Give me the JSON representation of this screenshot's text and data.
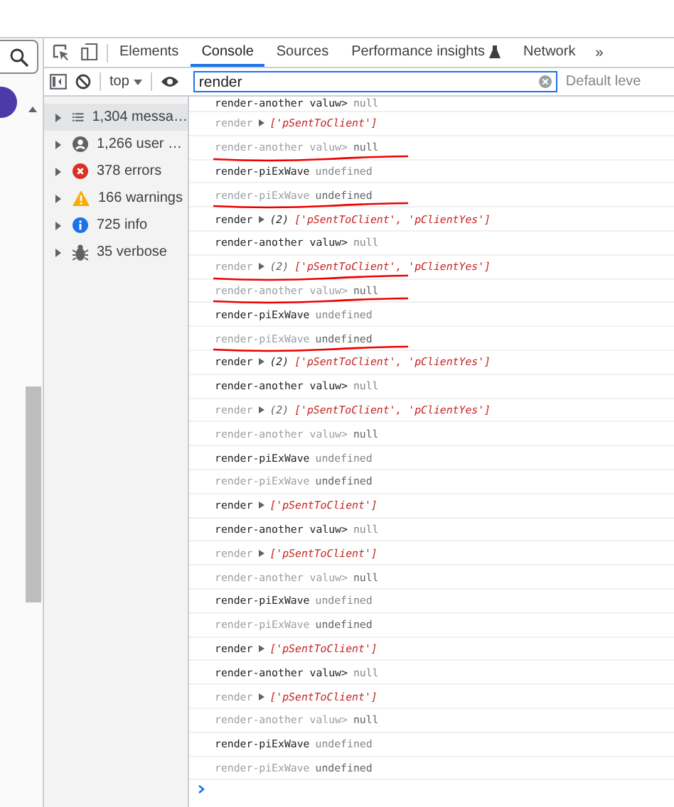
{
  "tabs": [
    {
      "label": "Elements",
      "selected": false
    },
    {
      "label": "Console",
      "selected": true
    },
    {
      "label": "Sources",
      "selected": false
    },
    {
      "label": "Performance insights",
      "selected": false,
      "kind": "flask"
    },
    {
      "label": "Network",
      "selected": false
    }
  ],
  "more_tabs": "»",
  "toolbar": {
    "context": "top",
    "filter": {
      "value": "render"
    },
    "levels": "Default leve"
  },
  "sidebar": {
    "items": [
      {
        "kind": "list",
        "label": "1,304 messa…",
        "selected": true
      },
      {
        "kind": "user",
        "label": "1,266 user …",
        "selected": false
      },
      {
        "kind": "error",
        "label": "378 errors",
        "selected": false
      },
      {
        "kind": "warning",
        "label": "166 warnings",
        "selected": false
      },
      {
        "kind": "info",
        "label": "725 info",
        "selected": false
      },
      {
        "kind": "bug",
        "label": "35 verbose",
        "selected": false
      }
    ]
  },
  "log": [
    {
      "kind": "text",
      "label": "render-another valuw>",
      "value": "null",
      "dim": false,
      "marked": false
    },
    {
      "kind": "array",
      "label": "render",
      "value": "['pSentToClient']",
      "dim": true,
      "marked": false
    },
    {
      "kind": "text",
      "label": "render-another valuw>",
      "value": "null",
      "dim": true,
      "marked": true
    },
    {
      "kind": "text",
      "label": "render-piExWave",
      "value": "undefined",
      "dim": false,
      "marked": false
    },
    {
      "kind": "text",
      "label": "render-piExWave",
      "value": "undefined",
      "dim": true,
      "marked": true
    },
    {
      "kind": "array",
      "label": "render",
      "count": "(2)",
      "value": "['pSentToClient', 'pClientYes']",
      "dim": false,
      "marked": false
    },
    {
      "kind": "text",
      "label": "render-another valuw>",
      "value": "null",
      "dim": false,
      "marked": false
    },
    {
      "kind": "array",
      "label": "render",
      "count": "(2)",
      "value": "['pSentToClient', 'pClientYes']",
      "dim": true,
      "marked": true
    },
    {
      "kind": "text",
      "label": "render-another valuw>",
      "value": "null",
      "dim": true,
      "marked": true
    },
    {
      "kind": "text",
      "label": "render-piExWave",
      "value": "undefined",
      "dim": false,
      "marked": false
    },
    {
      "kind": "text",
      "label": "render-piExWave",
      "value": "undefined",
      "dim": true,
      "marked": true
    },
    {
      "kind": "array",
      "label": "render",
      "count": "(2)",
      "value": "['pSentToClient', 'pClientYes']",
      "dim": false,
      "marked": false
    },
    {
      "kind": "text",
      "label": "render-another valuw>",
      "value": "null",
      "dim": false,
      "marked": false
    },
    {
      "kind": "array",
      "label": "render",
      "count": "(2)",
      "value": "['pSentToClient', 'pClientYes']",
      "dim": true,
      "marked": false
    },
    {
      "kind": "text",
      "label": "render-another valuw>",
      "value": "null",
      "dim": true,
      "marked": false
    },
    {
      "kind": "text",
      "label": "render-piExWave",
      "value": "undefined",
      "dim": false,
      "marked": false
    },
    {
      "kind": "text",
      "label": "render-piExWave",
      "value": "undefined",
      "dim": true,
      "marked": false
    },
    {
      "kind": "array",
      "label": "render",
      "value": "['pSentToClient']",
      "dim": false,
      "marked": false
    },
    {
      "kind": "text",
      "label": "render-another valuw>",
      "value": "null",
      "dim": false,
      "marked": false
    },
    {
      "kind": "array",
      "label": "render",
      "value": "['pSentToClient']",
      "dim": true,
      "marked": false
    },
    {
      "kind": "text",
      "label": "render-another valuw>",
      "value": "null",
      "dim": true,
      "marked": false
    },
    {
      "kind": "text",
      "label": "render-piExWave",
      "value": "undefined",
      "dim": false,
      "marked": false
    },
    {
      "kind": "text",
      "label": "render-piExWave",
      "value": "undefined",
      "dim": true,
      "marked": false
    },
    {
      "kind": "array",
      "label": "render",
      "value": "['pSentToClient']",
      "dim": false,
      "marked": false
    },
    {
      "kind": "text",
      "label": "render-another valuw>",
      "value": "null",
      "dim": false,
      "marked": false
    },
    {
      "kind": "array",
      "label": "render",
      "value": "['pSentToClient']",
      "dim": true,
      "marked": false
    },
    {
      "kind": "text",
      "label": "render-another valuw>",
      "value": "null",
      "dim": true,
      "marked": false
    },
    {
      "kind": "text",
      "label": "render-piExWave",
      "value": "undefined",
      "dim": false,
      "marked": false
    },
    {
      "kind": "text",
      "label": "render-piExWave",
      "value": "undefined",
      "dim": true,
      "marked": false
    }
  ]
}
